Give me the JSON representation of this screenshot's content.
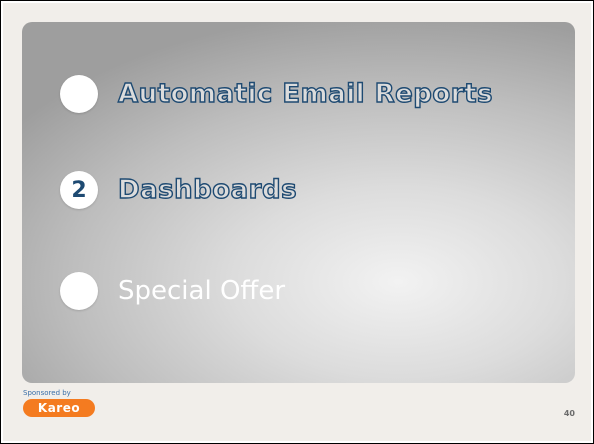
{
  "slide": {
    "items": [
      {
        "number": "",
        "label": "Automatic Email Reports",
        "style": "outlined"
      },
      {
        "number": "2",
        "label": "Dashboards",
        "style": "outlined"
      },
      {
        "number": "",
        "label": "Special Offer",
        "style": "plain"
      }
    ],
    "sponsor_text": "Sponsored by",
    "logo_text": "Kareo",
    "page_number": "40"
  },
  "colors": {
    "accent_navy": "#1e4a72",
    "logo_orange": "#f47b20",
    "slide_background": "#f1eeea"
  }
}
